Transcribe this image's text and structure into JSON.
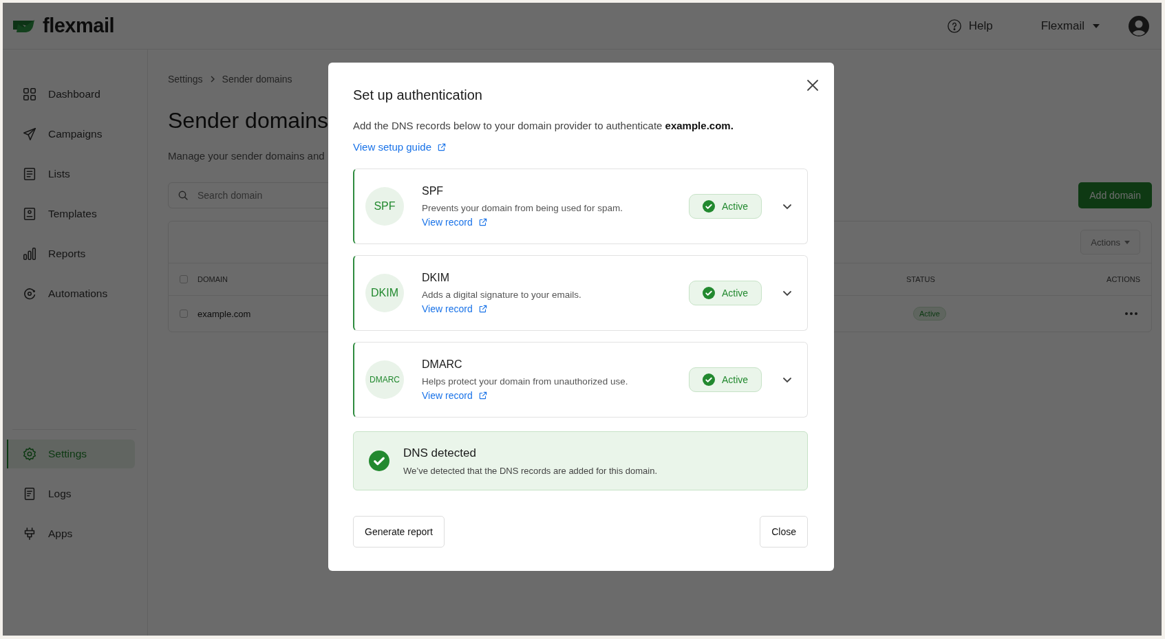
{
  "header": {
    "logo": "flexmail",
    "help": "Help",
    "account": "Flexmail"
  },
  "sidebar": {
    "items": [
      {
        "label": "Dashboard",
        "selected": false
      },
      {
        "label": "Campaigns",
        "selected": false
      },
      {
        "label": "Lists",
        "selected": false
      },
      {
        "label": "Templates",
        "selected": false
      },
      {
        "label": "Reports",
        "selected": false
      },
      {
        "label": "Automations",
        "selected": false
      }
    ],
    "bottom_items": [
      {
        "label": "Settings",
        "selected": true
      },
      {
        "label": "Logs",
        "selected": false
      },
      {
        "label": "Apps",
        "selected": false
      }
    ]
  },
  "page": {
    "breadcrumb": [
      "Settings",
      "Sender domains"
    ],
    "title": "Sender domains",
    "subtitle": "Manage your sender domains and",
    "search": {
      "placeholder": "Search domain"
    },
    "add_button": "Add domain",
    "actions_button": "Actions"
  },
  "table": {
    "select_all_checked": false,
    "columns": [
      "DOMAIN",
      "STATUS",
      "ACTIONS"
    ],
    "rows": [
      {
        "checked": false,
        "domain": "example.com",
        "status": "Active"
      }
    ]
  },
  "modal": {
    "title": "Set up authentication",
    "description": "Add the DNS records below to your domain provider to authenticate **example.com.**",
    "guide_link": "View setup guide",
    "records": [
      {
        "badge": "SPF",
        "name": "SPF",
        "description": "Prevents your domain from being used for spam.",
        "link": "View record",
        "status": "Active"
      },
      {
        "badge": "DKIM",
        "name": "DKIM",
        "description": "Adds a digital signature to your emails.",
        "link": "View record",
        "status": "Active"
      },
      {
        "badge": "DMARC",
        "name": "DMARC",
        "description": "Helps protect your domain from unauthorized use.",
        "link": "View record",
        "status": "Active"
      }
    ],
    "notice": {
      "title": "DNS detected",
      "text": "We’ve detected that the DNS records are added for this domain."
    },
    "buttons": [
      "Generate report",
      "Close"
    ]
  }
}
